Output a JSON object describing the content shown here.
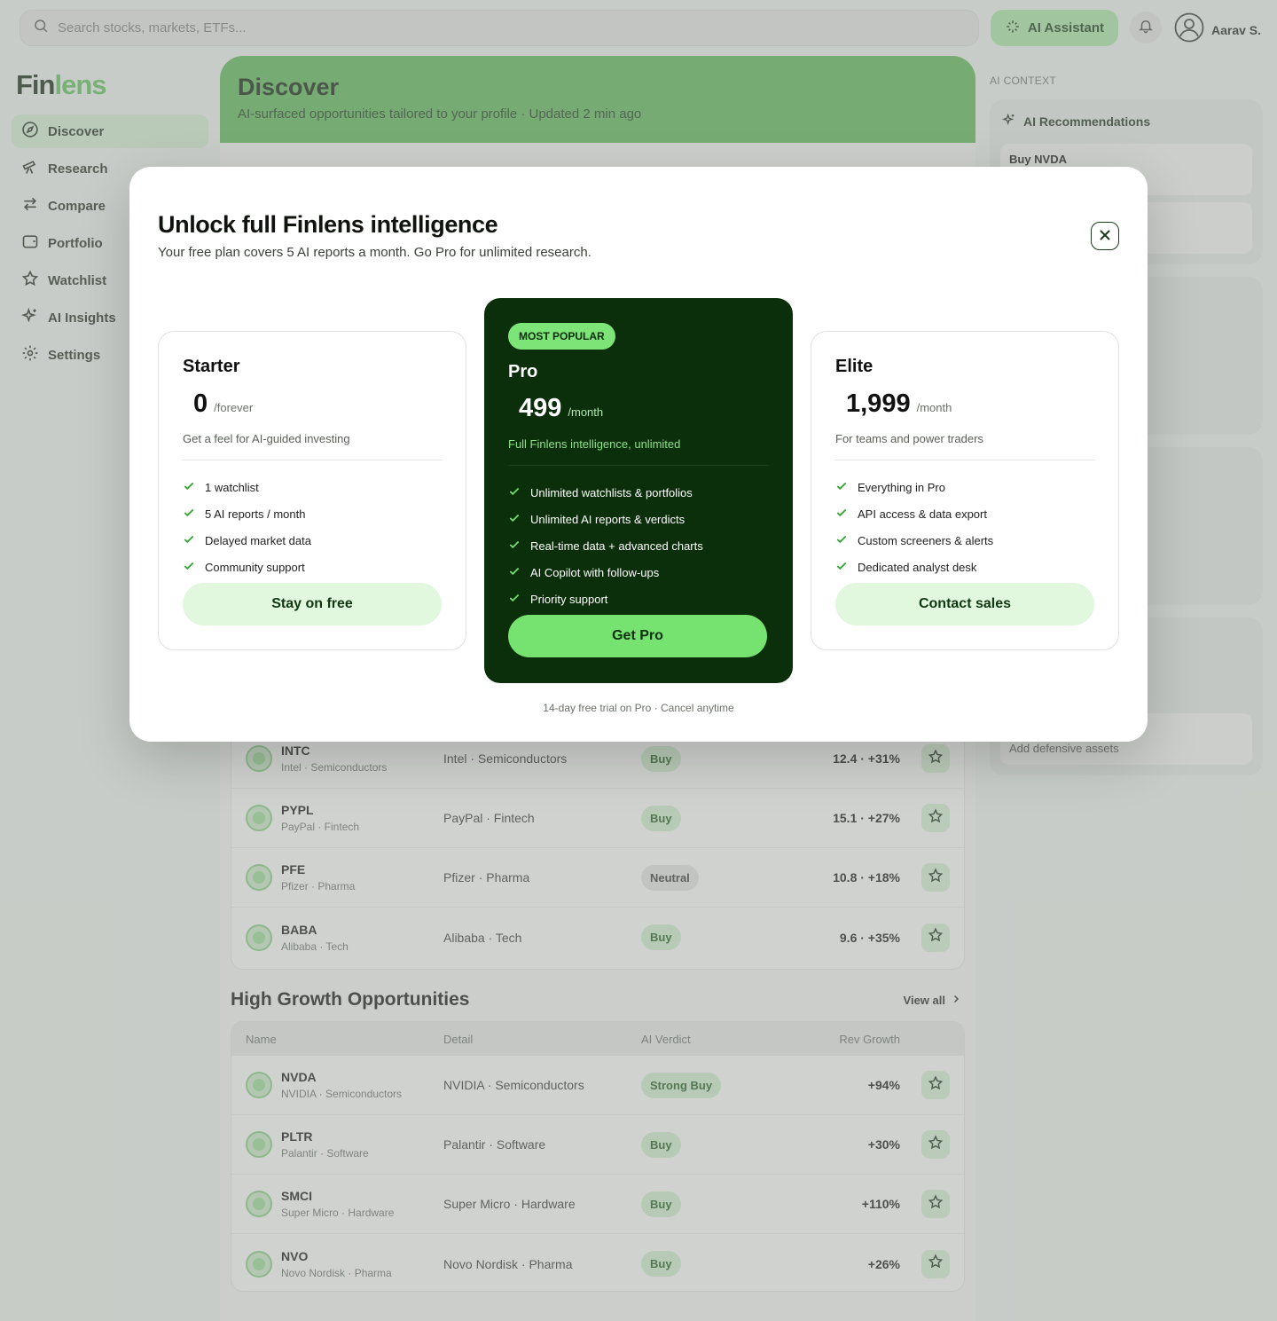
{
  "search": {
    "placeholder": "Search stocks, markets, ETFs..."
  },
  "header": {
    "ai_button": "AI Assistant",
    "user_name": "Aarav S."
  },
  "brand": {
    "part1": "Fin",
    "part2": "lens",
    "accent": "#5fc45a"
  },
  "sidebar": {
    "items": [
      {
        "label": "Discover",
        "icon": "compass-icon",
        "active": true
      },
      {
        "label": "Research",
        "icon": "telescope-icon"
      },
      {
        "label": "Compare",
        "icon": "arrows-swap-icon"
      },
      {
        "label": "Portfolio",
        "icon": "wallet-icon"
      },
      {
        "label": "Watchlist",
        "icon": "star-icon"
      },
      {
        "label": "AI Insights",
        "icon": "sparkles-icon"
      },
      {
        "label": "Settings",
        "icon": "gear-icon"
      }
    ]
  },
  "hero": {
    "title": "Discover",
    "subtitle": "AI-surfaced opportunities tailored to your profile · Updated 2 min ago",
    "color": "#5cb957"
  },
  "table1": {
    "rows": [
      {
        "ticker": "INTC",
        "sub": "Intel · Semiconductors",
        "detail": "Intel · Semiconductors",
        "verdict": "Buy",
        "value": "12.4 · +31%"
      },
      {
        "ticker": "PYPL",
        "sub": "PayPal · Fintech",
        "detail": "PayPal · Fintech",
        "verdict": "Buy",
        "value": "15.1 · +27%"
      },
      {
        "ticker": "PFE",
        "sub": "Pfizer · Pharma",
        "detail": "Pfizer · Pharma",
        "verdict": "Neutral",
        "value": "10.8 · +18%"
      },
      {
        "ticker": "BABA",
        "sub": "Alibaba · Tech",
        "detail": "Alibaba · Tech",
        "verdict": "Buy",
        "value": "9.6 · +35%"
      }
    ]
  },
  "growth": {
    "title": "High Growth Opportunities",
    "view_all": "View all",
    "headers": {
      "name": "Name",
      "detail": "Detail",
      "verdict": "AI Verdict",
      "value": "Rev Growth"
    },
    "rows": [
      {
        "ticker": "NVDA",
        "sub": "NVIDIA · Semiconductors",
        "detail": "NVIDIA · Semiconductors",
        "verdict": "Strong Buy",
        "value": "+94%"
      },
      {
        "ticker": "PLTR",
        "sub": "Palantir · Software",
        "detail": "Palantir · Software",
        "verdict": "Buy",
        "value": "+30%"
      },
      {
        "ticker": "SMCI",
        "sub": "Super Micro · Hardware",
        "detail": "Super Micro · Hardware",
        "verdict": "Buy",
        "value": "+110%"
      },
      {
        "ticker": "NVO",
        "sub": "Novo Nordisk · Pharma",
        "detail": "Novo Nordisk · Pharma",
        "verdict": "Buy",
        "value": "+26%"
      }
    ]
  },
  "right_panel": {
    "label": "AI CONTEXT",
    "recommendations_title": "AI Recommendations",
    "first_item": "Buy NVDA",
    "last_item": "Add defensive assets"
  },
  "modal": {
    "title": "Unlock full Finlens intelligence",
    "subtitle": "Your free plan covers 5 AI reports a month. Go Pro for unlimited research.",
    "footnote": "14-day free trial on Pro · Cancel anytime",
    "plans": {
      "starter": {
        "name": "Starter",
        "price": "0",
        "period": "/forever",
        "desc": "Get a feel for AI-guided investing",
        "features": [
          "1 watchlist",
          "5 AI reports / month",
          "Delayed market data",
          "Community support"
        ],
        "cta": "Stay on free"
      },
      "pro": {
        "badge": "MOST POPULAR",
        "name": "Pro",
        "price": "499",
        "period": "/month",
        "desc": "Full Finlens intelligence, unlimited",
        "features": [
          "Unlimited watchlists & portfolios",
          "Unlimited AI reports & verdicts",
          "Real-time data + advanced charts",
          "AI Copilot with follow-ups",
          "Priority support"
        ],
        "cta": "Get Pro"
      },
      "elite": {
        "name": "Elite",
        "price": "1,999",
        "period": "/month",
        "desc": "For teams and power traders",
        "features": [
          "Everything in Pro",
          "API access & data export",
          "Custom screeners & alerts",
          "Dedicated analyst desk"
        ],
        "cta": "Contact sales"
      }
    }
  }
}
